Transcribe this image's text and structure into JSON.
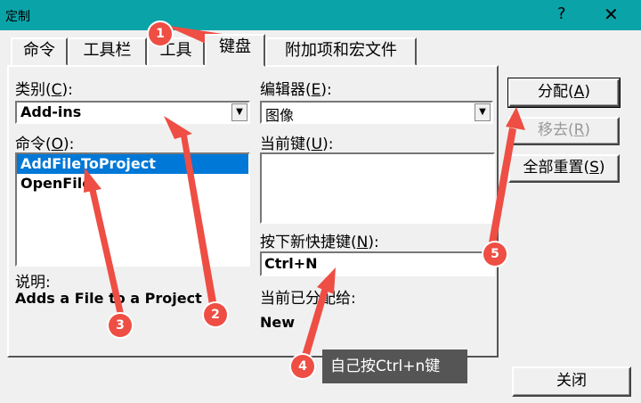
{
  "window": {
    "title": "定制",
    "help_glyph": "?",
    "close_glyph": "✕"
  },
  "tabs": [
    "命令",
    "工具栏",
    "工具",
    "键盘",
    "附加项和宏文件"
  ],
  "category": {
    "label_prefix": "类别(",
    "hotkey": "C",
    "label_suffix": "):",
    "value": "Add-ins"
  },
  "commands": {
    "label_prefix": "命令(",
    "hotkey": "O",
    "label_suffix": "):",
    "items": [
      "AddFileToProject",
      "OpenFile"
    ],
    "selected_index": 0
  },
  "description": {
    "label": "说明:",
    "text": "Adds a File to a Project"
  },
  "editor": {
    "label_prefix": "编辑器(",
    "hotkey": "E",
    "label_suffix": "):",
    "value": "图像"
  },
  "current_keys": {
    "label_prefix": "当前键(",
    "hotkey": "U",
    "label_suffix": "):"
  },
  "new_shortcut": {
    "label_prefix": "按下新快捷键(",
    "hotkey": "N",
    "label_suffix": "):",
    "value": "Ctrl+N"
  },
  "assigned_to": {
    "label": "当前已分配给:",
    "value": "New"
  },
  "buttons": {
    "assign_prefix": "分配(",
    "assign_hotkey": "A",
    "assign_suffix": ")",
    "remove_prefix": "移去(",
    "remove_hotkey": "R",
    "remove_suffix": ")",
    "reset_prefix": "全部重置(",
    "reset_hotkey": "S",
    "reset_suffix": ")",
    "close": "关闭"
  },
  "annotations": {
    "badges": [
      "1",
      "2",
      "3",
      "4",
      "5"
    ],
    "callout": "自己按Ctrl+n键",
    "color": "#ee4e44"
  },
  "colors": {
    "titlebar": "#0aa3a8",
    "selection": "#0078d7"
  }
}
